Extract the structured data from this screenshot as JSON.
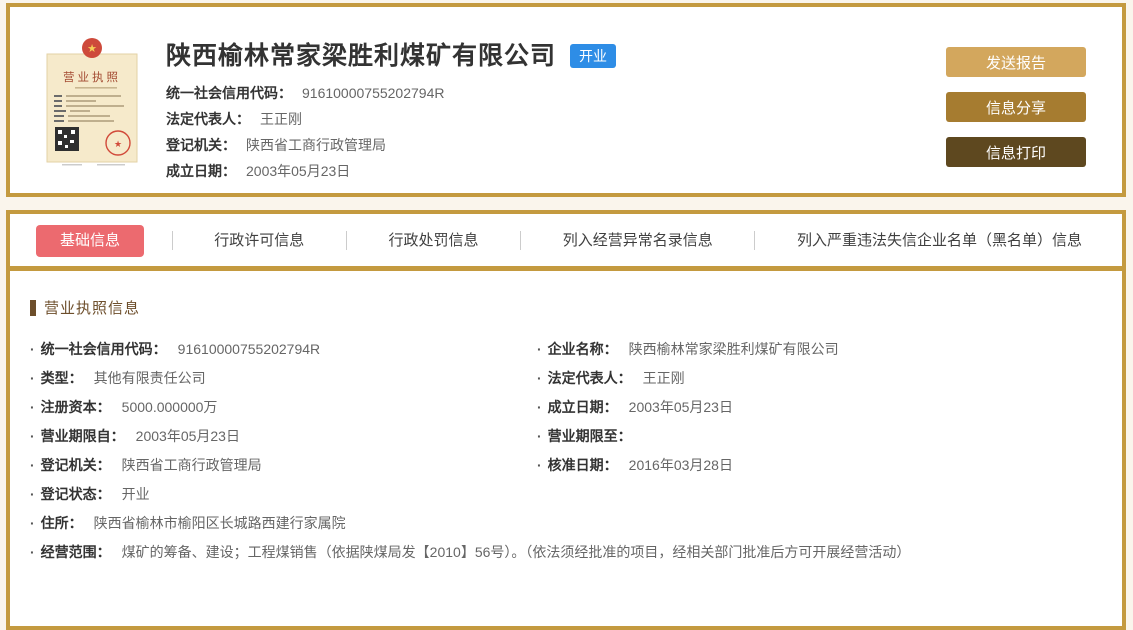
{
  "theme": {
    "gold_border": "#c49a3f",
    "page_bg": "#faf5ec",
    "active_tab_bg": "#ec6a6f",
    "status_badge_bg": "#2e8de6",
    "section_title_color": "#6d4e2b",
    "btn_send_bg": "#d3a75d",
    "btn_share_bg": "#a67c30",
    "btn_print_bg": "#5e481f"
  },
  "symbols": {
    "bullet": "·"
  },
  "header": {
    "company_name": "陕西榆林常家梁胜利煤矿有限公司",
    "status_badge": "开业",
    "license_thumb_title": "营业执照",
    "fields": [
      {
        "label": "统一社会信用代码：",
        "value": "91610000755202794R"
      },
      {
        "label": "法定代表人：",
        "value": "王正刚"
      },
      {
        "label": "登记机关：",
        "value": "陕西省工商行政管理局"
      },
      {
        "label": "成立日期：",
        "value": "2003年05月23日"
      }
    ],
    "buttons": [
      "发送报告",
      "信息分享",
      "信息打印"
    ]
  },
  "tabs": [
    {
      "label": "基础信息",
      "active": true
    },
    {
      "label": "行政许可信息",
      "active": false
    },
    {
      "label": "行政处罚信息",
      "active": false
    },
    {
      "label": "列入经营异常名录信息",
      "active": false
    },
    {
      "label": "列入严重违法失信企业名单（黑名单）信息",
      "active": false
    }
  ],
  "section": {
    "title": "营业执照信息"
  },
  "details": {
    "pairs": [
      {
        "l_label": "统一社会信用代码：",
        "l_value": "91610000755202794R",
        "r_label": "企业名称：",
        "r_value": "陕西榆林常家梁胜利煤矿有限公司"
      },
      {
        "l_label": "类型：",
        "l_value": "其他有限责任公司",
        "r_label": "法定代表人：",
        "r_value": "王正刚"
      },
      {
        "l_label": "注册资本：",
        "l_value": "5000.000000万",
        "r_label": "成立日期：",
        "r_value": "2003年05月23日"
      },
      {
        "l_label": "营业期限自：",
        "l_value": "2003年05月23日",
        "r_label": "营业期限至：",
        "r_value": ""
      },
      {
        "l_label": "登记机关：",
        "l_value": "陕西省工商行政管理局",
        "r_label": "核准日期：",
        "r_value": "2016年03月28日"
      },
      {
        "l_label": "登记状态：",
        "l_value": "开业"
      }
    ],
    "full_rows": [
      {
        "label": "住所：",
        "value": "陕西省榆林市榆阳区长城路西建行家属院"
      },
      {
        "label": "经营范围：",
        "value": "煤矿的筹备、建设；工程煤销售（依据陕煤局发【2010】56号）。（依法须经批准的项目，经相关部门批准后方可开展经营活动）"
      }
    ]
  }
}
